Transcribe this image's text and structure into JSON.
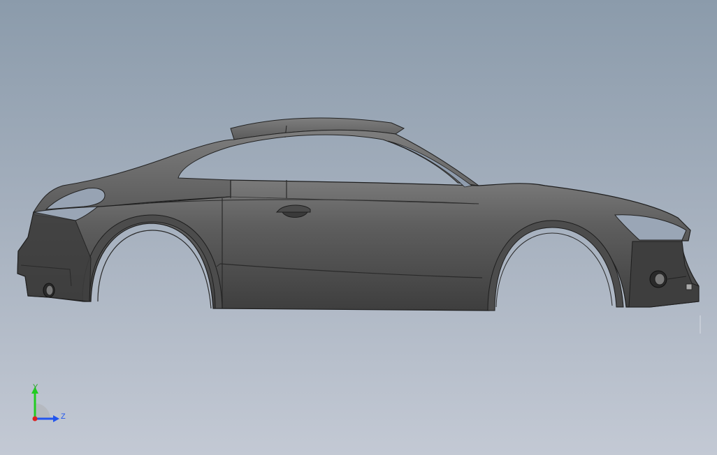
{
  "viewport": {
    "background_top": "#8b9bab",
    "background_bottom": "#c3c9d4"
  },
  "model": {
    "body_color": "#5a5a5a",
    "shadow_color": "#3c3c3c",
    "highlight_color": "#8a8a8a",
    "edge_color": "#1e1e1e"
  },
  "triad": {
    "y_label": "Y",
    "z_label": "Z",
    "y_color": "#22cc22",
    "z_color": "#2255ee",
    "x_color": "#dd2222"
  }
}
